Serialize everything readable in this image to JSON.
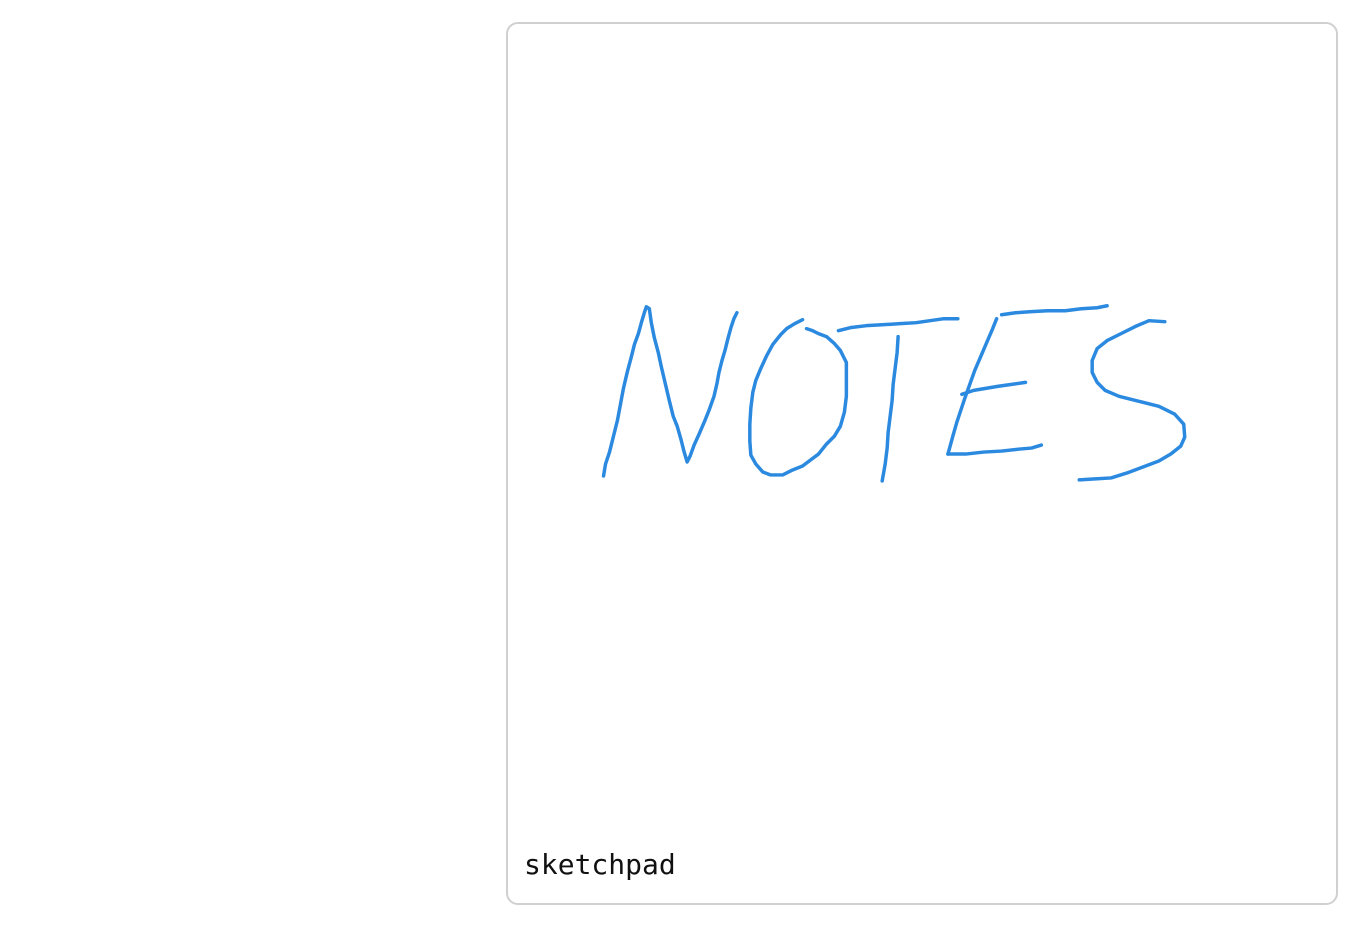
{
  "sketchpad": {
    "label": "sketchpad",
    "ink_color": "#2b8ae0",
    "drawn_text": "NOTES"
  }
}
